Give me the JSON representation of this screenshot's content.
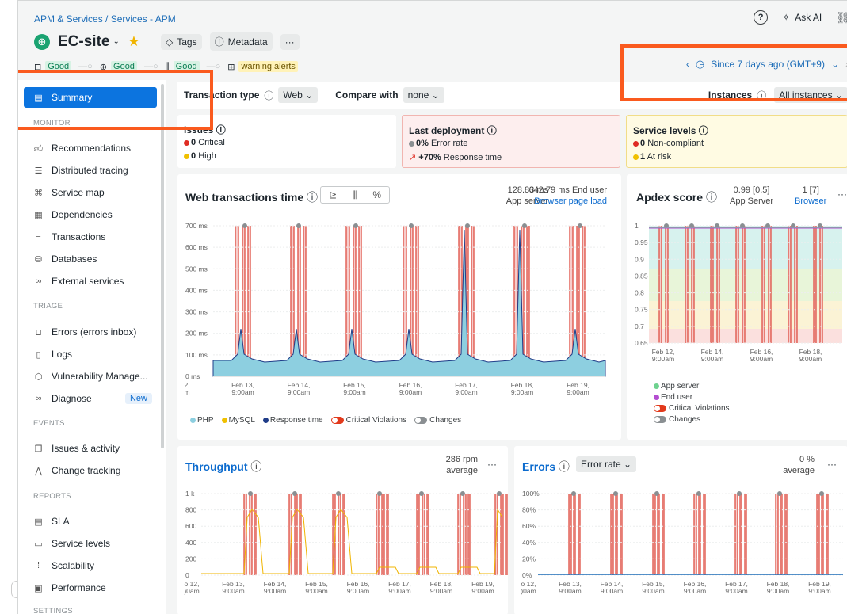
{
  "breadcrumb": "APM & Services / Services - APM",
  "topbar": {
    "help_icon": "help-circle-icon",
    "ask_ai": "Ask AI"
  },
  "entity": {
    "name": "EC-site",
    "tags": "Tags",
    "metadata": "Metadata",
    "more": "···"
  },
  "status": {
    "apm": "Good",
    "browser": "Good",
    "infra": "Good",
    "alerts": "warning alerts"
  },
  "timepicker": {
    "label": "Since 7 days ago (GMT+9)"
  },
  "sidebar": {
    "summary": "Summary",
    "monitor_title": "MONITOR",
    "monitor": [
      "Recommendations",
      "Distributed tracing",
      "Service map",
      "Dependencies",
      "Transactions",
      "Databases",
      "External services"
    ],
    "triage_title": "TRIAGE",
    "triage": [
      "Errors (errors inbox)",
      "Logs",
      "Vulnerability Manage...",
      "Diagnose"
    ],
    "diagnose_badge": "New",
    "events_title": "EVENTS",
    "events": [
      "Issues & activity",
      "Change tracking"
    ],
    "reports_title": "REPORTS",
    "reports": [
      "SLA",
      "Service levels",
      "Scalability",
      "Performance"
    ],
    "settings_title": "SETTINGS"
  },
  "filters": {
    "transaction_type_label": "Transaction type",
    "transaction_type_value": "Web",
    "compare_label": "Compare with",
    "compare_value": "none",
    "instances_label": "Instances",
    "instances_value": "All instances"
  },
  "issues": {
    "title": "Issues",
    "critical_count": "0",
    "critical_label": "Critical",
    "high_count": "0",
    "high_label": "High"
  },
  "deployment": {
    "title": "Last deployment",
    "error_rate_value": "0%",
    "error_rate_label": "Error rate",
    "response_value": "+70%",
    "response_label": "Response time"
  },
  "service_levels": {
    "title": "Service levels",
    "noncompliant_count": "0",
    "noncompliant_label": "Non-compliant",
    "risk_count": "1",
    "risk_label": "At risk"
  },
  "web_tx": {
    "title": "Web transactions time",
    "app_value": "128.83 ms",
    "app_label": "App server",
    "browser_value": "642.79 ms",
    "browser_label1": "End user",
    "browser_label2": "Browser page load",
    "y_ticks": [
      "700 ms",
      "600 ms",
      "500 ms",
      "400 ms",
      "300 ms",
      "200 ms",
      "100 ms",
      "0 ms"
    ],
    "x_ticks": [
      [
        "2,",
        "m"
      ],
      [
        "Feb 13,",
        "9:00am"
      ],
      [
        "Feb 14,",
        "9:00am"
      ],
      [
        "Feb 15,",
        "9:00am"
      ],
      [
        "Feb 16,",
        "9:00am"
      ],
      [
        "Feb 17,",
        "9:00am"
      ],
      [
        "Feb 18,",
        "9:00am"
      ],
      [
        "Feb 19,",
        "9:00am"
      ]
    ],
    "legend": {
      "php": "PHP",
      "mysql": "MySQL",
      "response": "Response time",
      "violations": "Critical Violations",
      "changes": "Changes"
    }
  },
  "apdex": {
    "title": "Apdex score",
    "app_value": "0.99 [0.5]",
    "app_label": "App Server",
    "browser_value": "1 [7]",
    "browser_label": "Browser",
    "y_ticks": [
      "1",
      "0.95",
      "0.9",
      "0.85",
      "0.8",
      "0.75",
      "0.7",
      "0.65"
    ],
    "x_ticks": [
      [
        "Feb 12,",
        "9:00am"
      ],
      [
        "Feb 14,",
        "9:00am"
      ],
      [
        "Feb 16,",
        "9:00am"
      ],
      [
        "Feb 18,",
        "9:00am"
      ],
      [
        "F",
        ""
      ]
    ],
    "legend": {
      "app": "App server",
      "end_user": "End user",
      "violations": "Critical Violations",
      "changes": "Changes"
    }
  },
  "throughput": {
    "title": "Throughput",
    "value": "286 rpm",
    "sub": "average",
    "y_ticks": [
      "1 k",
      "800",
      "600",
      "400",
      "200",
      "0"
    ],
    "x_ticks": [
      [
        "o 12,",
        ")0am"
      ],
      [
        "Feb 13,",
        "9:00am"
      ],
      [
        "Feb 14,",
        "9:00am"
      ],
      [
        "Feb 15,",
        "9:00am"
      ],
      [
        "Feb 16,",
        "9:00am"
      ],
      [
        "Feb 17,",
        "9:00am"
      ],
      [
        "Feb 18,",
        "9:00am"
      ],
      [
        "Feb 19,",
        "9:00am"
      ]
    ]
  },
  "errors": {
    "title": "Errors",
    "dropdown": "Error rate",
    "value": "0 %",
    "sub": "average",
    "y_ticks": [
      "100%",
      "80%",
      "60%",
      "40%",
      "20%",
      "0%"
    ],
    "x_ticks": [
      [
        "o 12,",
        ")0am"
      ],
      [
        "Feb 13,",
        "9:00am"
      ],
      [
        "Feb 14,",
        "9:00am"
      ],
      [
        "Feb 15,",
        "9:00am"
      ],
      [
        "Feb 16,",
        "9:00am"
      ],
      [
        "Feb 17,",
        "9:00am"
      ],
      [
        "Feb 18,",
        "9:00am"
      ],
      [
        "Feb 19,",
        "9:00am"
      ]
    ]
  },
  "colors": {
    "accent": "#0c74df",
    "highlight": "#fa5a1e",
    "violation": "#e8a3a0",
    "area": "#8dcfe0",
    "good": "#1aa371"
  }
}
